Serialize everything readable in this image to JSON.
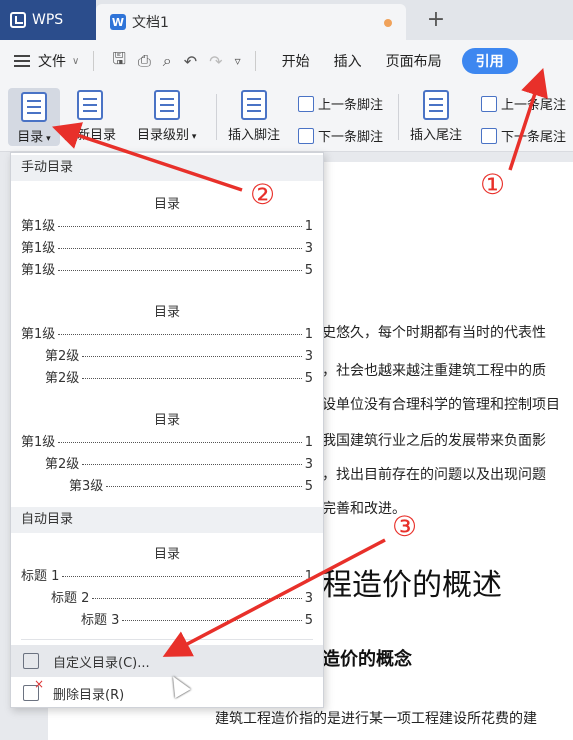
{
  "titlebar": {
    "app_tab": "WPS",
    "doc_tab": "文档1",
    "new_tab_symbol": "+"
  },
  "menubar": {
    "file_label": "文件",
    "items": [
      "开始",
      "插入",
      "页面布局"
    ],
    "active_item": "引用"
  },
  "toolbar": {
    "toc_label": "目录",
    "update_toc_label": "更新目录",
    "toc_level_label": "目录级别",
    "insert_footnote_label": "插入脚注",
    "prev_footnote_label": "上一条脚注",
    "next_footnote_label": "下一条脚注",
    "insert_endnote_label": "插入尾注",
    "prev_endnote_label": "上一条尾注",
    "next_endnote_label": "下一条尾注"
  },
  "dropdown": {
    "manual_header": "手动目录",
    "auto_header": "自动目录",
    "presets": [
      {
        "title": "目录",
        "rows": [
          {
            "label": "第1级",
            "page": "1"
          },
          {
            "label": "第1级",
            "page": "3"
          },
          {
            "label": "第1级",
            "page": "5"
          }
        ]
      },
      {
        "title": "目录",
        "rows": [
          {
            "label": "第1级",
            "page": "1"
          },
          {
            "label": "第2级",
            "page": "3"
          },
          {
            "label": "第2级",
            "page": "5"
          }
        ]
      },
      {
        "title": "目录",
        "rows": [
          {
            "label": "第1级",
            "page": "1"
          },
          {
            "label": "第2级",
            "page": "3"
          },
          {
            "label": "第3级",
            "page": "5"
          }
        ]
      },
      {
        "title": "目录",
        "rows": [
          {
            "label": "标题 1",
            "page": "1"
          },
          {
            "label": "标题 2",
            "page": "3"
          },
          {
            "label": "标题 3",
            "page": "5"
          }
        ]
      }
    ],
    "custom_toc_label": "自定义目录(C)...",
    "delete_toc_label": "删除目录(R)"
  },
  "document": {
    "lines": [
      "史悠久，每个时期都有当时的代表性",
      "，社会也越来越注重建筑工程中的质",
      "设单位没有合理科学的管理和控制项目",
      "我国建筑行业之后的发展带来负面影",
      "，找出目前存在的问题以及出现问题",
      "完善和改进。"
    ],
    "heading1": "程造价的概述",
    "heading2": "造价的概念",
    "last_line": "建筑工程造价指的是进行某一项工程建设所花费的建"
  },
  "annotations": {
    "mark1": "①",
    "mark2": "②",
    "mark3": "③",
    "color": "#e8302a"
  },
  "colors": {
    "accent": "#3d87f0",
    "wps_tab": "#2b4d8c"
  }
}
